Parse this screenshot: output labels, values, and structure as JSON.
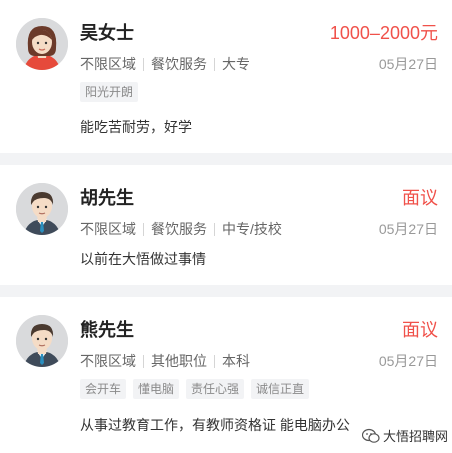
{
  "cards": [
    {
      "name": "吴女士",
      "salary": "1000–2000元",
      "meta": [
        "不限区域",
        "餐饮服务",
        "大专"
      ],
      "date": "05月27日",
      "tags": [
        "阳光开朗"
      ],
      "desc": "能吃苦耐劳，好学",
      "avatar": "female-avatar"
    },
    {
      "name": "胡先生",
      "salary": "面议",
      "meta": [
        "不限区域",
        "餐饮服务",
        "中专/技校"
      ],
      "date": "05月27日",
      "tags": [],
      "desc": "以前在大悟做过事情",
      "avatar": "male-avatar"
    },
    {
      "name": "熊先生",
      "salary": "面议",
      "meta": [
        "不限区域",
        "其他职位",
        "本科"
      ],
      "date": "05月27日",
      "tags": [
        "会开车",
        "懂电脑",
        "责任心强",
        "诚信正直"
      ],
      "desc": "从事过教育工作，有教师资格证 能电脑办公",
      "avatar": "male-avatar"
    }
  ],
  "watermark": "大悟招聘网",
  "colors": {
    "accent": "#f0514a",
    "background": "#f2f3f5"
  }
}
